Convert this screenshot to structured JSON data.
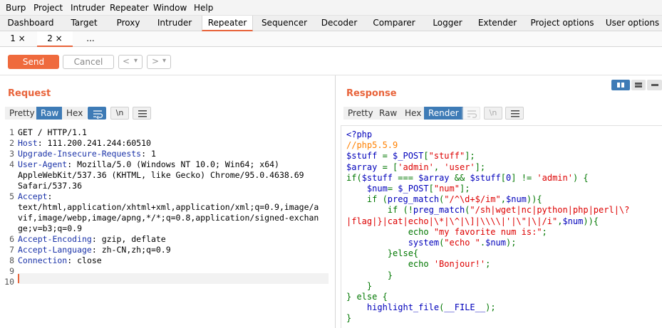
{
  "menu": [
    "Burp",
    "Project",
    "Intruder",
    "Repeater",
    "Window",
    "Help"
  ],
  "tabs": [
    "Dashboard",
    "Target",
    "Proxy",
    "Intruder",
    "Repeater",
    "Sequencer",
    "Decoder",
    "Comparer",
    "Logger",
    "Extender",
    "Project options",
    "User options"
  ],
  "active_tab": "Repeater",
  "subtabs": [
    {
      "label": "1 ×"
    },
    {
      "label": "2 ×"
    },
    {
      "label": "..."
    }
  ],
  "toolbar": {
    "send_label": "Send",
    "cancel_label": "Cancel",
    "prev_label": "<",
    "next_label": ">",
    "dropdown_glyph": "▾"
  },
  "request": {
    "title": "Request",
    "view_tabs": [
      "Pretty",
      "Raw",
      "Hex"
    ],
    "active_view": "Raw",
    "newline_label": "\\n",
    "lines": [
      {
        "num": "1",
        "name": "",
        "value": "GET / HTTP/1.1"
      },
      {
        "num": "2",
        "name": "Host",
        "value": ": 111.200.241.244:60510"
      },
      {
        "num": "3",
        "name": "Upgrade-Insecure-Requests",
        "value": ": 1"
      },
      {
        "num": "4",
        "name": "User-Agent",
        "value": ": Mozilla/5.0 (Windows NT 10.0; Win64; x64)"
      },
      {
        "num": "",
        "name": "",
        "value": "AppleWebKit/537.36 (KHTML, like Gecko) Chrome/95.0.4638.69"
      },
      {
        "num": "",
        "name": "",
        "value": "Safari/537.36"
      },
      {
        "num": "5",
        "name": "Accept",
        "value": ":"
      },
      {
        "num": "",
        "name": "",
        "value": "text/html,application/xhtml+xml,application/xml;q=0.9,image/a"
      },
      {
        "num": "",
        "name": "",
        "value": "vif,image/webp,image/apng,*/*;q=0.8,application/signed-exchan"
      },
      {
        "num": "",
        "name": "",
        "value": "ge;v=b3;q=0.9"
      },
      {
        "num": "6",
        "name": "Accept-Encoding",
        "value": ": gzip, deflate"
      },
      {
        "num": "7",
        "name": "Accept-Language",
        "value": ": zh-CN,zh;q=0.9"
      },
      {
        "num": "8",
        "name": "Connection",
        "value": ": close"
      },
      {
        "num": "9",
        "name": "",
        "value": ""
      },
      {
        "num": "10",
        "name": "",
        "value": ""
      }
    ]
  },
  "response": {
    "title": "Response",
    "view_tabs": [
      "Pretty",
      "Raw",
      "Hex",
      "Render"
    ],
    "active_view": "Render",
    "newline_label": "\\n",
    "code": [
      [
        {
          "t": "tag",
          "s": "<?php"
        }
      ],
      [
        {
          "t": "comment",
          "s": "//php5.5.9"
        }
      ],
      [
        {
          "t": "default",
          "s": "$stuff "
        },
        {
          "t": "keyword",
          "s": "= "
        },
        {
          "t": "default",
          "s": "$_POST"
        },
        {
          "t": "keyword",
          "s": "["
        },
        {
          "t": "string",
          "s": "\"stuff\""
        },
        {
          "t": "keyword",
          "s": "];"
        }
      ],
      [
        {
          "t": "default",
          "s": "$array "
        },
        {
          "t": "keyword",
          "s": "= ["
        },
        {
          "t": "string",
          "s": "'admin'"
        },
        {
          "t": "keyword",
          "s": ", "
        },
        {
          "t": "string",
          "s": "'user'"
        },
        {
          "t": "keyword",
          "s": "];"
        }
      ],
      [
        {
          "t": "keyword",
          "s": "if("
        },
        {
          "t": "default",
          "s": "$stuff "
        },
        {
          "t": "keyword",
          "s": "=== "
        },
        {
          "t": "default",
          "s": "$array "
        },
        {
          "t": "keyword",
          "s": "&& "
        },
        {
          "t": "default",
          "s": "$stuff"
        },
        {
          "t": "keyword",
          "s": "["
        },
        {
          "t": "default",
          "s": "0"
        },
        {
          "t": "keyword",
          "s": "] != "
        },
        {
          "t": "string",
          "s": "'admin'"
        },
        {
          "t": "keyword",
          "s": ") {"
        }
      ],
      [
        {
          "t": "keyword",
          "s": "    "
        },
        {
          "t": "default",
          "s": "$num"
        },
        {
          "t": "keyword",
          "s": "= "
        },
        {
          "t": "default",
          "s": "$_POST"
        },
        {
          "t": "keyword",
          "s": "["
        },
        {
          "t": "string",
          "s": "\"num\""
        },
        {
          "t": "keyword",
          "s": "];"
        }
      ],
      [
        {
          "t": "keyword",
          "s": "    if ("
        },
        {
          "t": "default",
          "s": "preg_match"
        },
        {
          "t": "keyword",
          "s": "("
        },
        {
          "t": "string",
          "s": "\"/^\\d+$/im\""
        },
        {
          "t": "keyword",
          "s": ","
        },
        {
          "t": "default",
          "s": "$num"
        },
        {
          "t": "keyword",
          "s": ")){"
        }
      ],
      [
        {
          "t": "keyword",
          "s": "        if (!"
        },
        {
          "t": "default",
          "s": "preg_match"
        },
        {
          "t": "keyword",
          "s": "("
        },
        {
          "t": "string",
          "s": "\"/sh|wget|nc|python|php|perl|\\?"
        }
      ],
      [
        {
          "t": "string",
          "s": "|flag|}|cat|echo|\\*|\\^|\\]|\\\\\\\\|'|\\\"|\\|/i\""
        },
        {
          "t": "keyword",
          "s": ","
        },
        {
          "t": "default",
          "s": "$num"
        },
        {
          "t": "keyword",
          "s": ")){"
        }
      ],
      [
        {
          "t": "keyword",
          "s": "            echo "
        },
        {
          "t": "string",
          "s": "\"my favorite num is:\""
        },
        {
          "t": "keyword",
          "s": ";"
        }
      ],
      [
        {
          "t": "keyword",
          "s": "            "
        },
        {
          "t": "default",
          "s": "system"
        },
        {
          "t": "keyword",
          "s": "("
        },
        {
          "t": "string",
          "s": "\"echo \""
        },
        {
          "t": "keyword",
          "s": "."
        },
        {
          "t": "default",
          "s": "$num"
        },
        {
          "t": "keyword",
          "s": ");"
        }
      ],
      [
        {
          "t": "keyword",
          "s": "        }else{"
        }
      ],
      [
        {
          "t": "keyword",
          "s": "            echo "
        },
        {
          "t": "string",
          "s": "'Bonjour!'"
        },
        {
          "t": "keyword",
          "s": ";"
        }
      ],
      [
        {
          "t": "keyword",
          "s": "        }"
        }
      ],
      [
        {
          "t": "keyword",
          "s": "    }"
        }
      ],
      [
        {
          "t": "keyword",
          "s": "} else {"
        }
      ],
      [
        {
          "t": "keyword",
          "s": "    "
        },
        {
          "t": "default",
          "s": "highlight_file"
        },
        {
          "t": "keyword",
          "s": "("
        },
        {
          "t": "default",
          "s": "__FILE__"
        },
        {
          "t": "keyword",
          "s": ");"
        }
      ],
      [
        {
          "t": "keyword",
          "s": "}"
        }
      ]
    ]
  },
  "colors": {
    "accent": "#e8633a",
    "active_view": "#3e7bb6",
    "header_name": "#1a32a8"
  }
}
